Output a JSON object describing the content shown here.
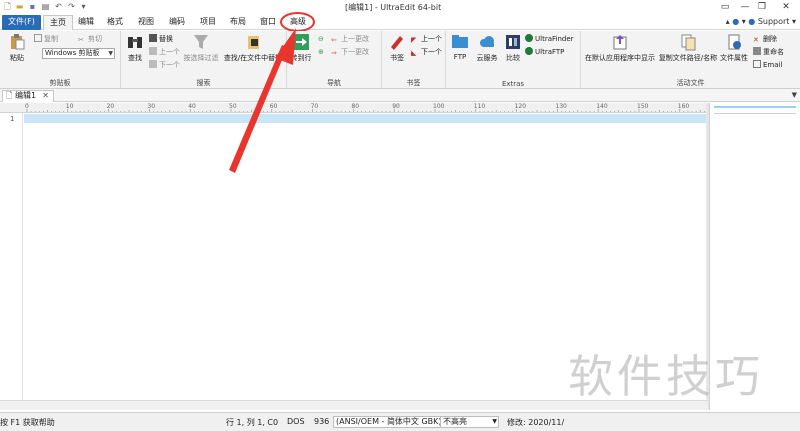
{
  "window": {
    "title": "[编辑1] - UltraEdit 64-bit"
  },
  "tabs": {
    "file": "文件(F)",
    "items": [
      "主页",
      "编辑",
      "格式",
      "视图",
      "编码",
      "项目",
      "布局",
      "窗口",
      "高级"
    ],
    "support": "Support"
  },
  "ribbon": {
    "clipboard": {
      "paste": "粘贴",
      "copy": "复制",
      "cut": "剪切",
      "clipboard_select": "Windows 剪贴板",
      "label": "剪贴板"
    },
    "search": {
      "find": "查找",
      "replace": "替换",
      "prev": "上一个",
      "next": "下一个",
      "filter": "按选择过滤",
      "find_in_files": "查找/在文件中替换",
      "label": "搜索"
    },
    "navigation": {
      "goto_line": "转到行",
      "prev_change": "上一更改",
      "next_change": "下一更改",
      "label": "导航"
    },
    "bookmarks": {
      "bookmark": "书签",
      "prev": "上一个",
      "next": "下一个",
      "label": "书签"
    },
    "extras": {
      "ftp": "FTP",
      "cloud": "云服务",
      "compare": "比较",
      "ultrafinder": "UltraFinder",
      "ultraftp": "UltraFTP",
      "label": "Extras"
    },
    "active_file": {
      "open_default": "在默认应用程序中显示",
      "copy_path": "复制文件路径/名称",
      "properties": "文件属性",
      "delete": "删除",
      "rename": "重命名",
      "email": "Email",
      "label": "活动文件"
    }
  },
  "document": {
    "tab": "编辑1",
    "line_number": "1"
  },
  "ruler": {
    "marks": [
      "0",
      "10",
      "20",
      "30",
      "40",
      "50",
      "60",
      "70",
      "80",
      "90",
      "100",
      "110",
      "120",
      "130",
      "140",
      "150",
      "160"
    ]
  },
  "status": {
    "help": "按 F1 获取帮助",
    "position": "行 1, 列 1, C0",
    "line_ending": "DOS",
    "codepage": "936",
    "encoding": "(ANSI/OEM - 简体中文 GBK)",
    "highlight": "不高亮",
    "modified": "修改:   2020/11/"
  },
  "watermark": "软件技巧",
  "colors": {
    "accent": "#2a6bb8",
    "annotation": "#e8352e",
    "current_line": "#c8e6f7"
  }
}
